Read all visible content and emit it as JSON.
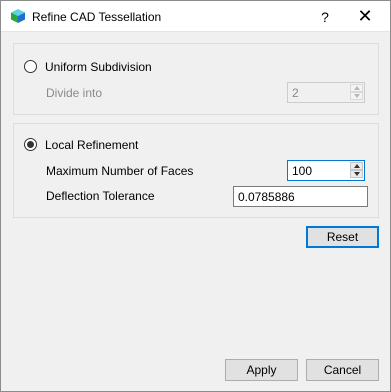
{
  "window": {
    "title": "Refine CAD Tessellation",
    "help": "?",
    "close": "✕"
  },
  "uniform": {
    "radio_label": "Uniform Subdivision",
    "checked": false,
    "divide_label": "Divide into",
    "divide_value": "2"
  },
  "local": {
    "radio_label": "Local Refinement",
    "checked": true,
    "max_faces_label": "Maximum Number of Faces",
    "max_faces_value": "100",
    "deflection_label": "Deflection Tolerance",
    "deflection_value": "0.0785886"
  },
  "buttons": {
    "reset": "Reset",
    "apply": "Apply",
    "cancel": "Cancel"
  }
}
